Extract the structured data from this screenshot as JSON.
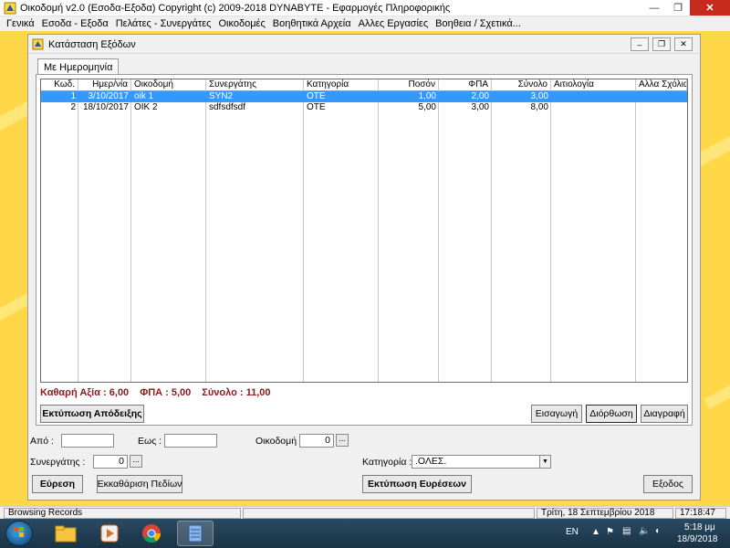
{
  "app": {
    "title": "Οικοδομή v2.0  (Εσοδα-Εξοδα)   Copyright (c) 2009-2018  DYNABYTE - Εφαρμογές Πληροφορικής",
    "menu": [
      "Γενικά",
      "Εσοδα - Εξοδα",
      "Πελάτες - Συνεργάτες",
      "Οικοδομές",
      "Βοηθητικά Αρχεία",
      "Αλλες Εργασίες",
      "Βοηθεια / Σχετικά..."
    ]
  },
  "window": {
    "title": "Κατάσταση Εξόδων",
    "tab": "Με Ημερομηνία"
  },
  "table": {
    "columns": [
      "Κωδ.",
      "Ημερ/νία",
      "Οικοδομή",
      "Συνεργάτης",
      "Κατηγορία",
      "Ποσόν",
      "ΦΠΑ",
      "Σύνολο",
      "Αιτιολογία",
      "Αλλα Σχόλια"
    ],
    "rows": [
      {
        "code": "1",
        "date": "3/10/2017",
        "building": "oik 1",
        "partner": "SYN2",
        "category": "OTE",
        "amount": "1,00",
        "vat": "2,00",
        "total": "3,00",
        "reason": "",
        "notes": ""
      },
      {
        "code": "2",
        "date": "18/10/2017",
        "building": "OIK 2",
        "partner": "sdfsdfsdf",
        "category": "OTE",
        "amount": "5,00",
        "vat": "3,00",
        "total": "8,00",
        "reason": "",
        "notes": ""
      }
    ]
  },
  "summary": {
    "net": "Καθαρή Αξία : 6,00",
    "vat": "ΦΠΑ : 5,00",
    "total": "Σύνολο : 11,00"
  },
  "buttons": {
    "print_receipt": "Εκτύπωση Απόδειξης",
    "insert": "Εισαγωγή",
    "edit": "Διόρθωση",
    "delete": "Διαγραφή",
    "search": "Εύρεση",
    "clear": "Εκκαθάριση Πεδίων",
    "print_results": "Εκτύπωση Ευρέσεων",
    "exit": "Εξοδος",
    "browse": "..."
  },
  "filters": {
    "from_label": "Από :",
    "from_value": "",
    "to_label": "Εως :",
    "to_value": "",
    "building_label": "Οικοδομή :",
    "building_value": "0",
    "partner_label": "Συνεργάτης :",
    "partner_value": "0",
    "category_label": "Κατηγορία :",
    "category_value": ".ΟΛΕΣ."
  },
  "status": {
    "mode": "Browsing Records",
    "date": "Τρίτη, 18 Σεπτεμβρίου 2018",
    "time": "17:18:47"
  },
  "taskbar": {
    "lang": "EN",
    "clock_time": "5:18 μμ",
    "clock_date": "18/9/2018",
    "apps": [
      "explorer-icon",
      "media-player-icon",
      "chrome-icon",
      "oikodomi-app-icon"
    ]
  },
  "colors": {
    "selection": "#3399ff",
    "summary_text": "#8b1a1a",
    "close_button": "#c42b1c",
    "background": "#ffd84a"
  }
}
